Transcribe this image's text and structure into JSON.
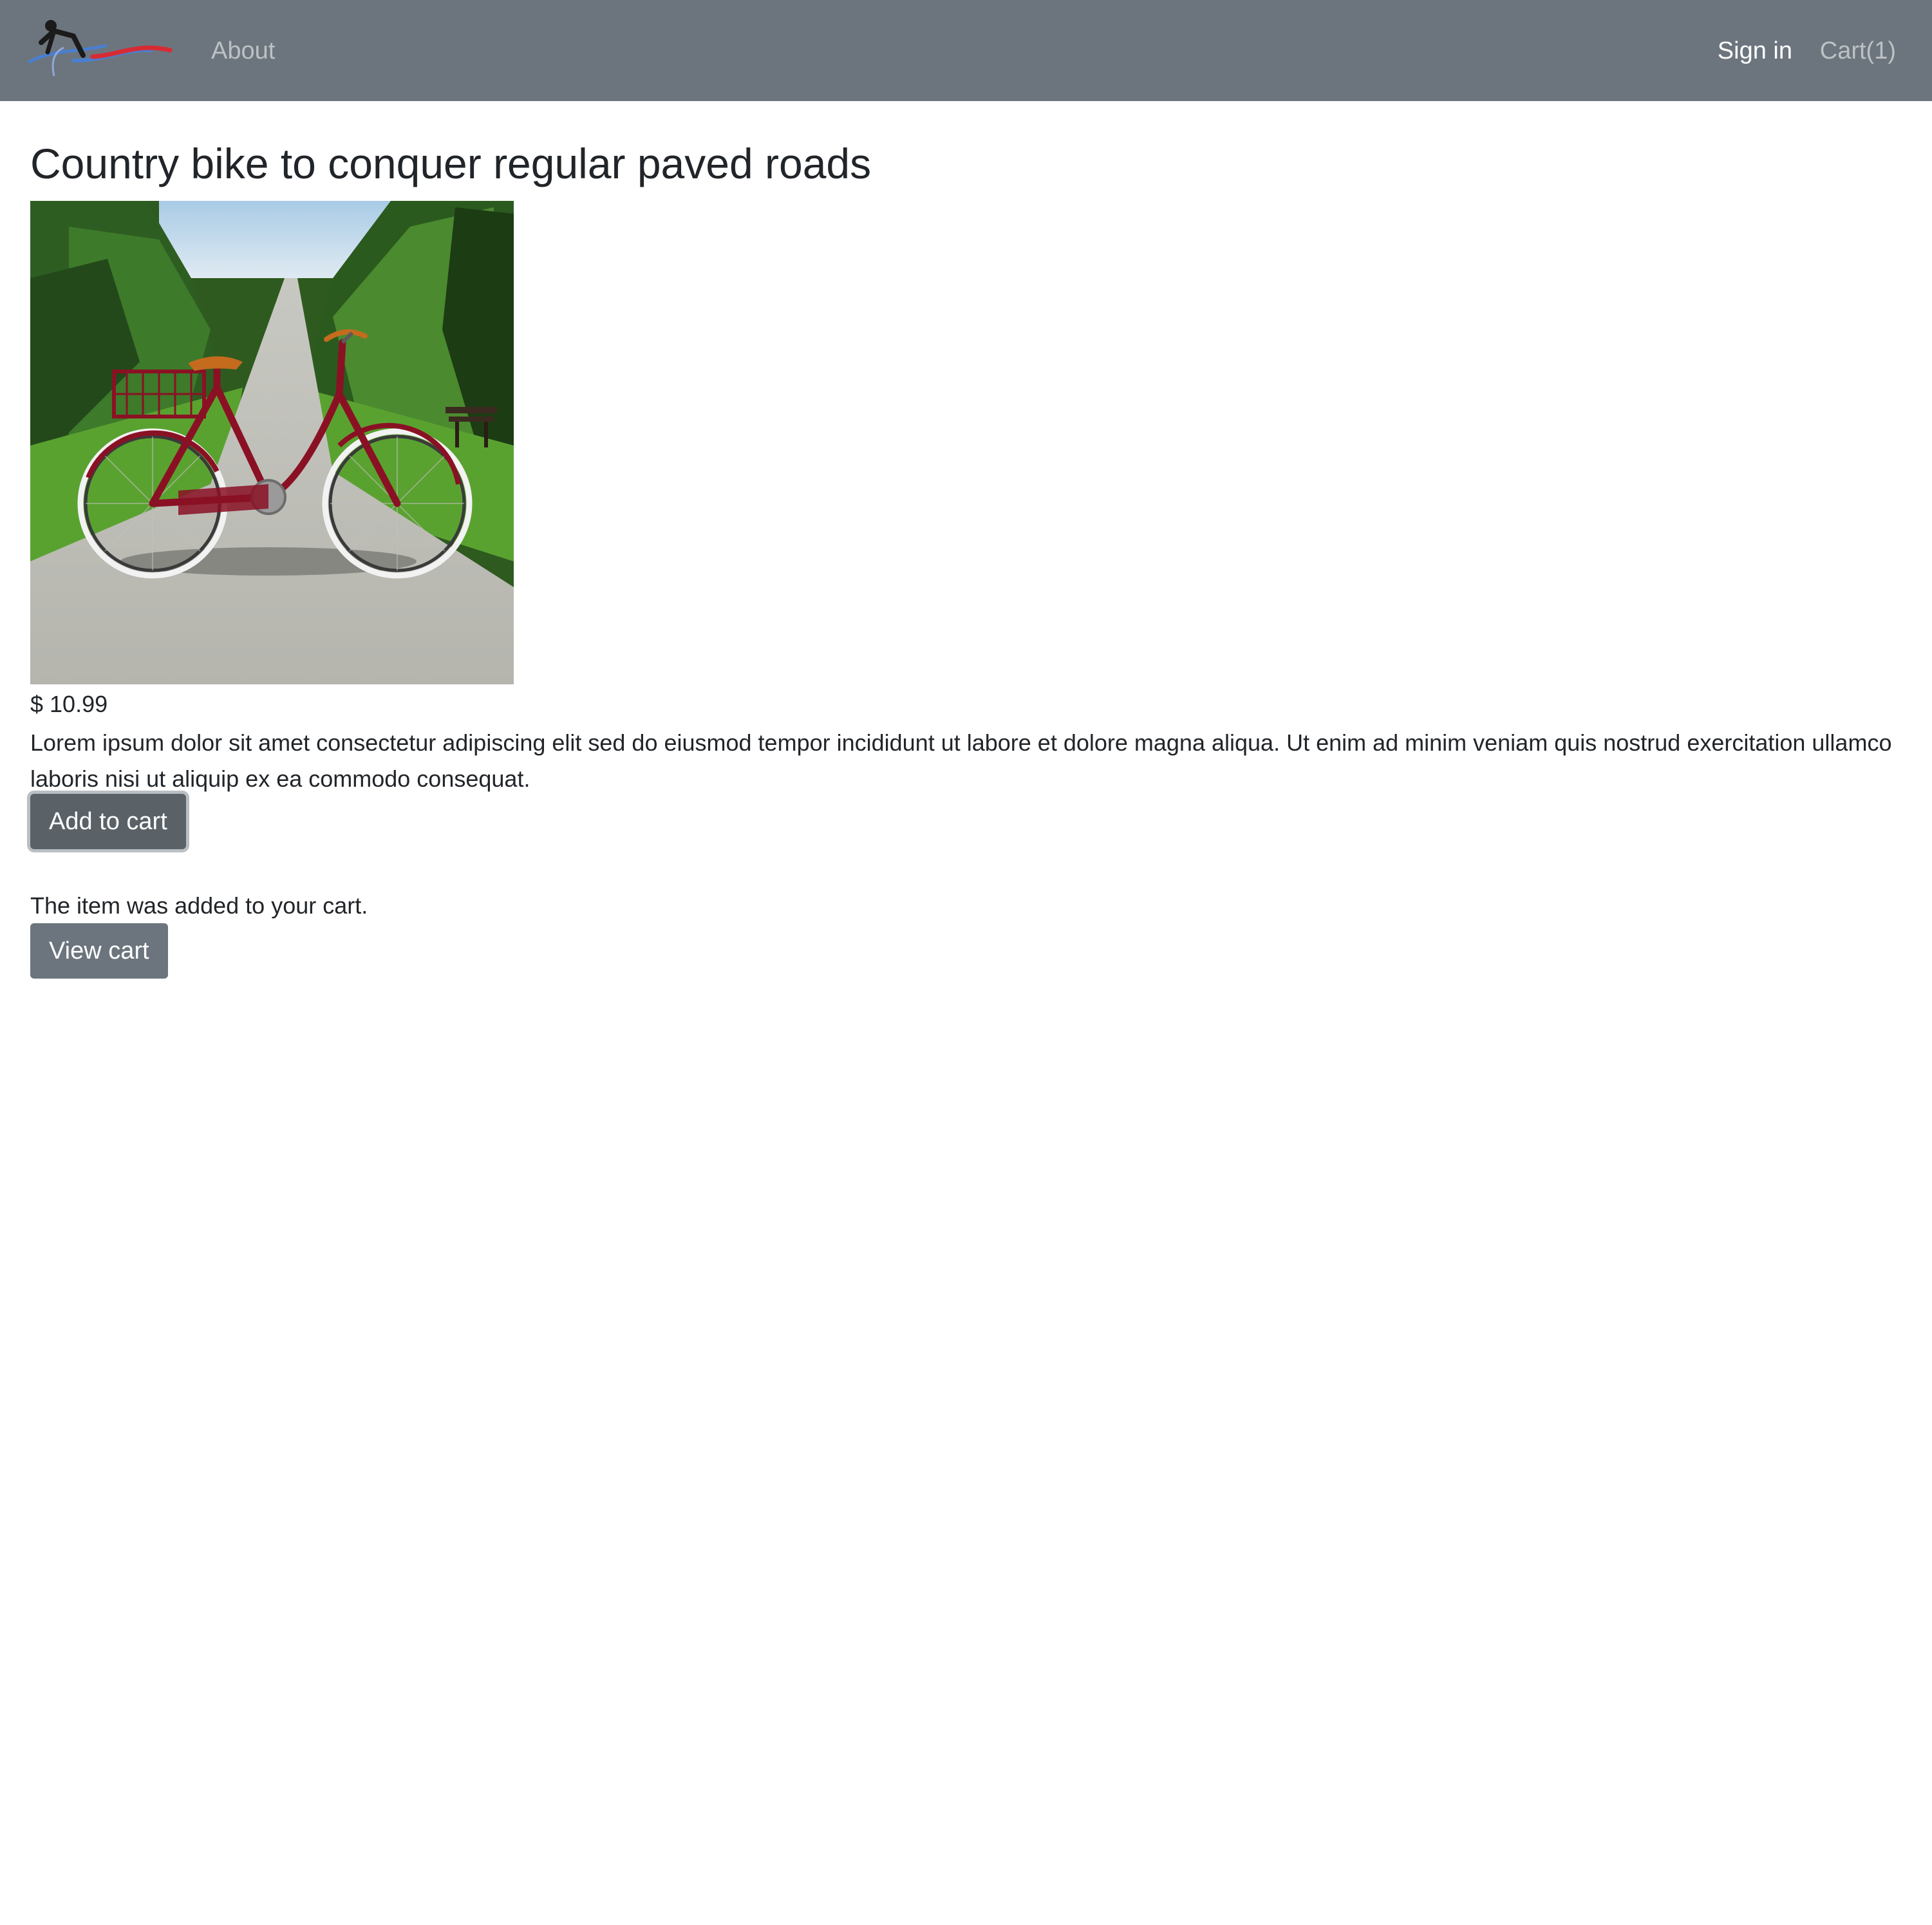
{
  "navbar": {
    "brand_logo_icon": "cyclist-logo-icon",
    "about_label": "About",
    "signin_label": "Sign in",
    "cart_label": "Cart(1)",
    "background_color": "#6c757d"
  },
  "product": {
    "title": "Country bike to conquer regular paved roads",
    "image_subject": "red-city-bike-with-basket-photo",
    "price": "$ 10.99",
    "description": "Lorem ipsum dolor sit amet consectetur adipiscing elit sed do eiusmod tempor incididunt ut labore et dolore magna aliqua. Ut enim ad minim veniam quis nostrud exercitation ullamco laboris nisi ut aliquip ex ea commodo consequat.",
    "add_to_cart_label": "Add to cart"
  },
  "cart_notice": {
    "message": "The item was added to your cart.",
    "view_cart_label": "View cart"
  }
}
